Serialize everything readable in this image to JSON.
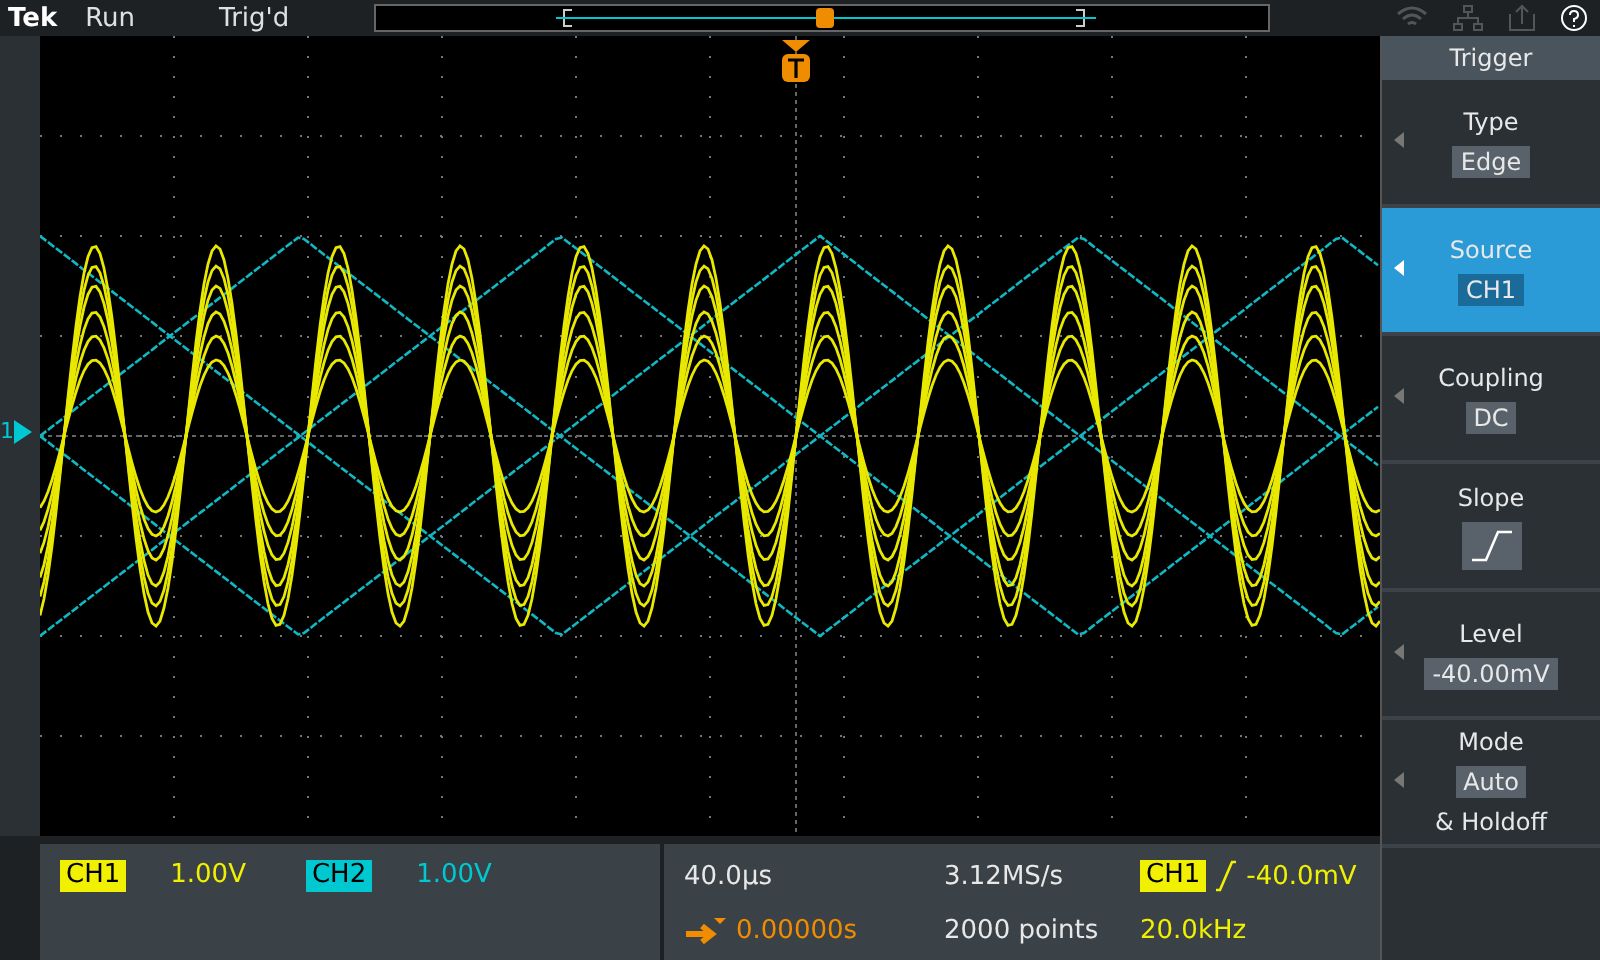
{
  "status_bar": {
    "logo": "Tek",
    "acquisition": "Run",
    "trigger_state": "Trig'd"
  },
  "graticule": {
    "channel_marker": "1"
  },
  "trigger_menu": {
    "title": "Trigger",
    "items": [
      {
        "label": "Type",
        "kind": "text",
        "value": "Edge",
        "selected": false,
        "has_arrow": true
      },
      {
        "label": "Source",
        "kind": "text",
        "value": "CH1",
        "selected": true,
        "has_arrow": true
      },
      {
        "label": "Coupling",
        "kind": "text",
        "value": "DC",
        "selected": false,
        "has_arrow": true
      },
      {
        "label": "Slope",
        "kind": "slope",
        "selected": false,
        "has_arrow": false
      },
      {
        "label": "Level",
        "kind": "text",
        "value": "-40.00mV",
        "selected": false,
        "has_arrow": true
      },
      {
        "label": "Mode",
        "kind": "text",
        "value": "Auto",
        "note": "& Holdoff",
        "selected": false,
        "has_arrow": true
      }
    ]
  },
  "channels": [
    {
      "label": "CH1",
      "scale": "1.00V",
      "color": "#f0f000"
    },
    {
      "label": "CH2",
      "scale": "1.00V",
      "color": "#00c8d0"
    }
  ],
  "horizontal": {
    "scale": "40.0µs",
    "sample_rate": "3.12MS/s",
    "position": "0.00000s",
    "record_length": "2000 points"
  },
  "trigger_readout": {
    "source": "CH1",
    "level": "-40.0mV",
    "frequency": "20.0kHz"
  }
}
